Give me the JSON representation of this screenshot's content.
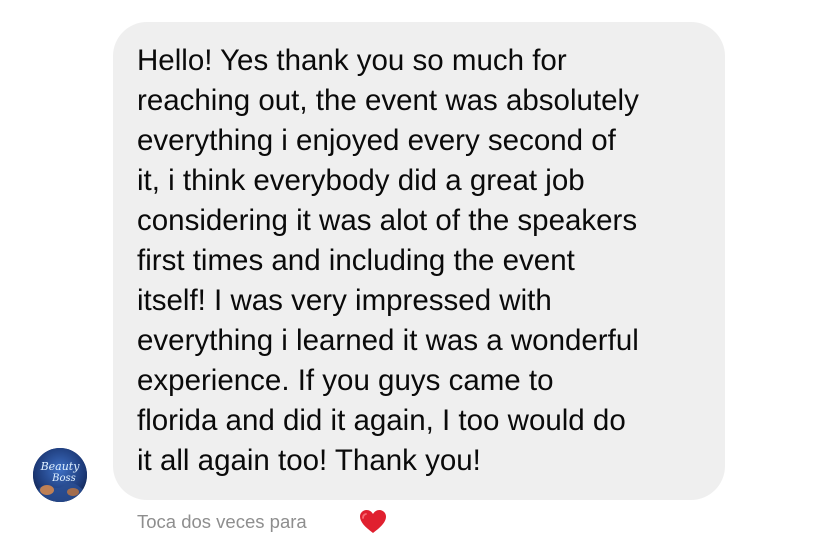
{
  "message": {
    "lines": [
      "Hello! Yes thank you so much for",
      "reaching out, the event was absolutely",
      "everything i enjoyed every second of",
      "it, i think everybody did a great job",
      "considering it was alot of the speakers",
      "first times and including the event",
      "itself! I was very impressed with",
      "everything i learned it was a wonderful",
      "experience. If you guys came to",
      "florida and did it again, I too would do",
      "it all again too! Thank you!"
    ]
  },
  "avatar": {
    "logo_text": "Beauty Boss",
    "colors": {
      "background": "#1d3a78",
      "glow": "#7fb6ff",
      "text": "#dff0ff",
      "accent": "#d98a4b"
    }
  },
  "hint": {
    "text": "Toca dos veces para",
    "icon": "heart-icon",
    "icon_color": "#e0202f"
  },
  "colors": {
    "bubble": "#efefef",
    "text": "#0a0a0a",
    "hint": "#8e8e8e",
    "background": "#ffffff"
  }
}
